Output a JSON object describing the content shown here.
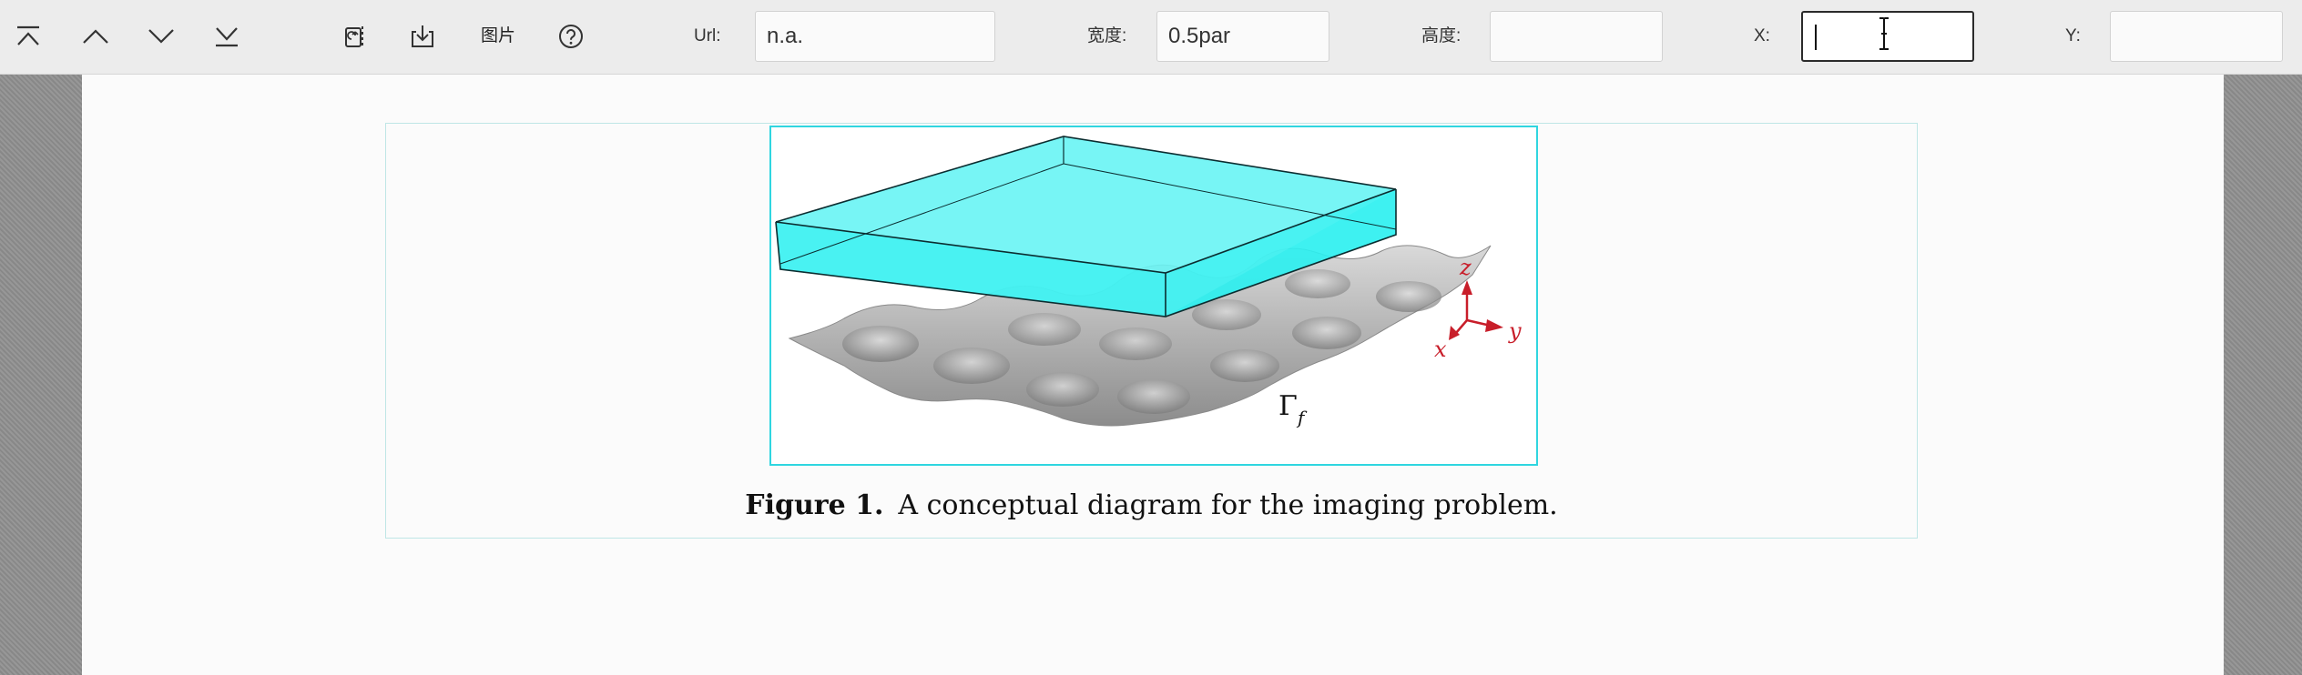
{
  "toolbar": {
    "buttons": [
      {
        "name": "first-page-button",
        "icon": "first-page-icon"
      },
      {
        "name": "previous-page-button",
        "icon": "chevron-up-icon"
      },
      {
        "name": "next-page-button",
        "icon": "chevron-down-icon"
      },
      {
        "name": "last-page-button",
        "icon": "last-page-icon"
      },
      {
        "name": "replace-file-button",
        "icon": "file-replace-icon"
      },
      {
        "name": "download-button",
        "icon": "download-icon"
      },
      {
        "name": "help-button",
        "icon": "help-icon"
      }
    ],
    "image_label": "图片",
    "url": {
      "label": "Url:",
      "value": "n.a."
    },
    "width": {
      "label": "宽度:",
      "value": "0.5par"
    },
    "height": {
      "label": "高度:",
      "value": ""
    },
    "x": {
      "label": "X:",
      "value": ""
    },
    "y": {
      "label": "Y:",
      "value": ""
    }
  },
  "figure": {
    "caption_bold": "Figure 1.",
    "caption_text": "A conceptual diagram for the imaging problem.",
    "surface_label_main": "Γ",
    "surface_label_sub": "f",
    "axis_labels": {
      "z": "z",
      "x": "x",
      "y": "y"
    },
    "colors": {
      "slab": "#2cf0f0",
      "slab_top": "#8ff5f5",
      "axes": "#c81e2a",
      "frame": "#2fd6e0"
    }
  }
}
